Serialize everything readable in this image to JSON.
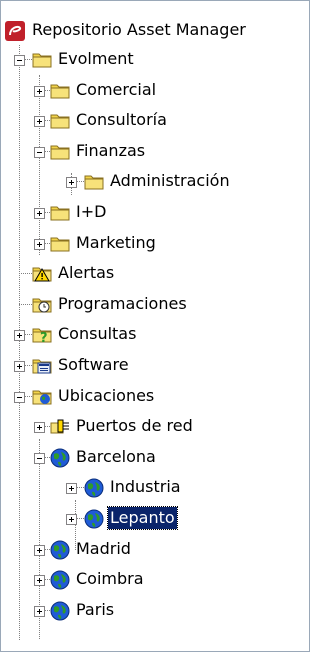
{
  "root": {
    "label": "Repositorio Asset Manager",
    "icon": "app-logo-icon"
  },
  "colors": {
    "selection_bg": "#0a246a",
    "folder": "#f2d44a",
    "globe_blue": "#1f5bd6",
    "globe_green": "#2f9b2a"
  },
  "tree": [
    {
      "id": "evolment",
      "label": "Evolment",
      "icon": "folder-icon",
      "level": 1,
      "expander": "minus"
    },
    {
      "id": "comercial",
      "label": "Comercial",
      "icon": "folder-icon",
      "level": 2,
      "expander": "plus"
    },
    {
      "id": "consultoria",
      "label": "Consultoría",
      "icon": "folder-icon",
      "level": 2,
      "expander": "plus"
    },
    {
      "id": "finanzas",
      "label": "Finanzas",
      "icon": "folder-icon",
      "level": 2,
      "expander": "minus"
    },
    {
      "id": "administracion",
      "label": "Administración",
      "icon": "folder-icon",
      "level": 3,
      "expander": "plus"
    },
    {
      "id": "i-d",
      "label": "I+D",
      "icon": "folder-icon",
      "level": 2,
      "expander": "plus"
    },
    {
      "id": "marketing",
      "label": "Marketing",
      "icon": "folder-icon",
      "level": 2,
      "expander": "plus"
    },
    {
      "id": "alertas",
      "label": "Alertas",
      "icon": "alert-folder-icon",
      "level": 1,
      "expander": "none"
    },
    {
      "id": "programaciones",
      "label": "Programaciones",
      "icon": "schedule-folder-icon",
      "level": 1,
      "expander": "none"
    },
    {
      "id": "consultas",
      "label": "Consultas",
      "icon": "query-folder-icon",
      "level": 1,
      "expander": "plus"
    },
    {
      "id": "software",
      "label": "Software",
      "icon": "software-folder-icon",
      "level": 1,
      "expander": "plus"
    },
    {
      "id": "ubicaciones",
      "label": "Ubicaciones",
      "icon": "globe-folder-icon",
      "level": 1,
      "expander": "minus"
    },
    {
      "id": "puertos-de-red",
      "label": "Puertos de red",
      "icon": "network-port-icon",
      "level": 2,
      "expander": "plus"
    },
    {
      "id": "barcelona",
      "label": "Barcelona",
      "icon": "globe-icon",
      "level": 2,
      "expander": "minus"
    },
    {
      "id": "industria",
      "label": "Industria",
      "icon": "globe-icon",
      "level": 3,
      "expander": "plus"
    },
    {
      "id": "lepanto",
      "label": "Lepanto",
      "icon": "globe-icon",
      "level": 3,
      "expander": "plus",
      "selected": true
    },
    {
      "id": "madrid",
      "label": "Madrid",
      "icon": "globe-icon",
      "level": 2,
      "expander": "plus"
    },
    {
      "id": "coimbra",
      "label": "Coimbra",
      "icon": "globe-icon",
      "level": 2,
      "expander": "plus"
    },
    {
      "id": "paris",
      "label": "Paris",
      "icon": "globe-icon",
      "level": 2,
      "expander": "plus"
    }
  ]
}
